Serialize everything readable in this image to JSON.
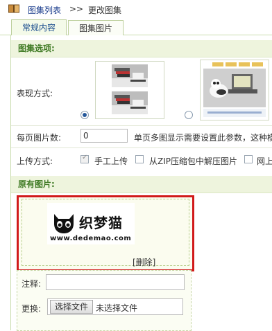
{
  "breadcrumb": {
    "link": "图集列表",
    "separator": ">>",
    "current": "更改图集"
  },
  "tabs": [
    {
      "label": "常规内容",
      "active": true
    },
    {
      "label": "图集图片",
      "active": false
    }
  ],
  "sections": {
    "album_options": "图集选项:",
    "original_images": "原有图片:"
  },
  "display": {
    "label": "表现方式:",
    "selected_option": 1
  },
  "per_page": {
    "label": "每页图片数:",
    "value": "0",
    "hint": "单页多图显示需要设置此参数，这种模"
  },
  "upload": {
    "label": "上传方式:",
    "options": [
      {
        "label": "手工上传",
        "checked": true
      },
      {
        "label": "从ZIP压缩包中解压图片",
        "checked": false
      },
      {
        "label": "网上",
        "checked": false
      }
    ]
  },
  "image_item": {
    "logo_text": "织梦猫",
    "logo_url": "www.dedemao.com",
    "delete_label": "[删除]",
    "note_label": "注释:",
    "note_value": "",
    "replace_label": "更换:",
    "choose_button": "选择文件",
    "no_file": "未选择文件"
  },
  "colors": {
    "section_title": "#3f7a24",
    "highlight_border": "#d11a1a",
    "link": "#1a3c8c"
  }
}
